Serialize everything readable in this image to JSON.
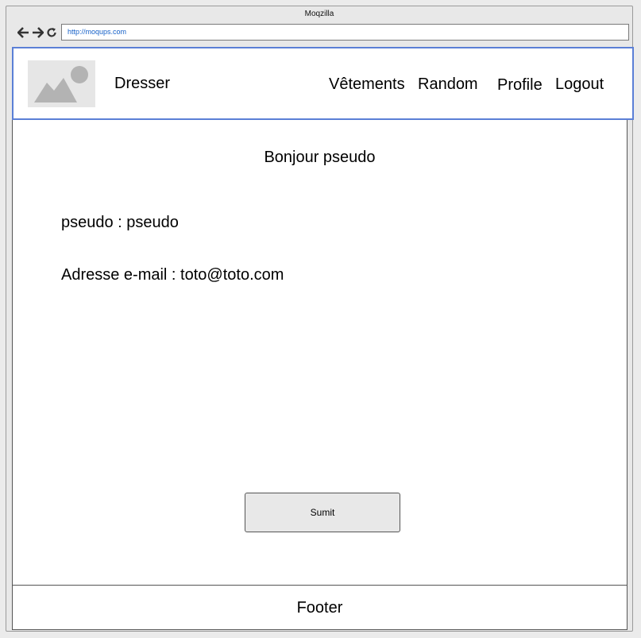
{
  "browser": {
    "title": "Moqzilla",
    "url": "http://moqups.com"
  },
  "header": {
    "brand": "Dresser",
    "logo_icon": "image-placeholder-icon",
    "menu": [
      {
        "label": "Vêtements"
      },
      {
        "label": "Random"
      },
      {
        "label": "Profile"
      },
      {
        "label": "Logout"
      }
    ]
  },
  "main": {
    "greeting": "Bonjour pseudo",
    "pseudo_line": "pseudo : pseudo",
    "email_line": "Adresse e-mail : toto@toto.com",
    "submit_label": "Sumit"
  },
  "footer": {
    "label": "Footer"
  },
  "colors": {
    "header_border": "#5b7fd6",
    "url_text": "#1560c8",
    "button_bg": "#e8e8e8"
  }
}
